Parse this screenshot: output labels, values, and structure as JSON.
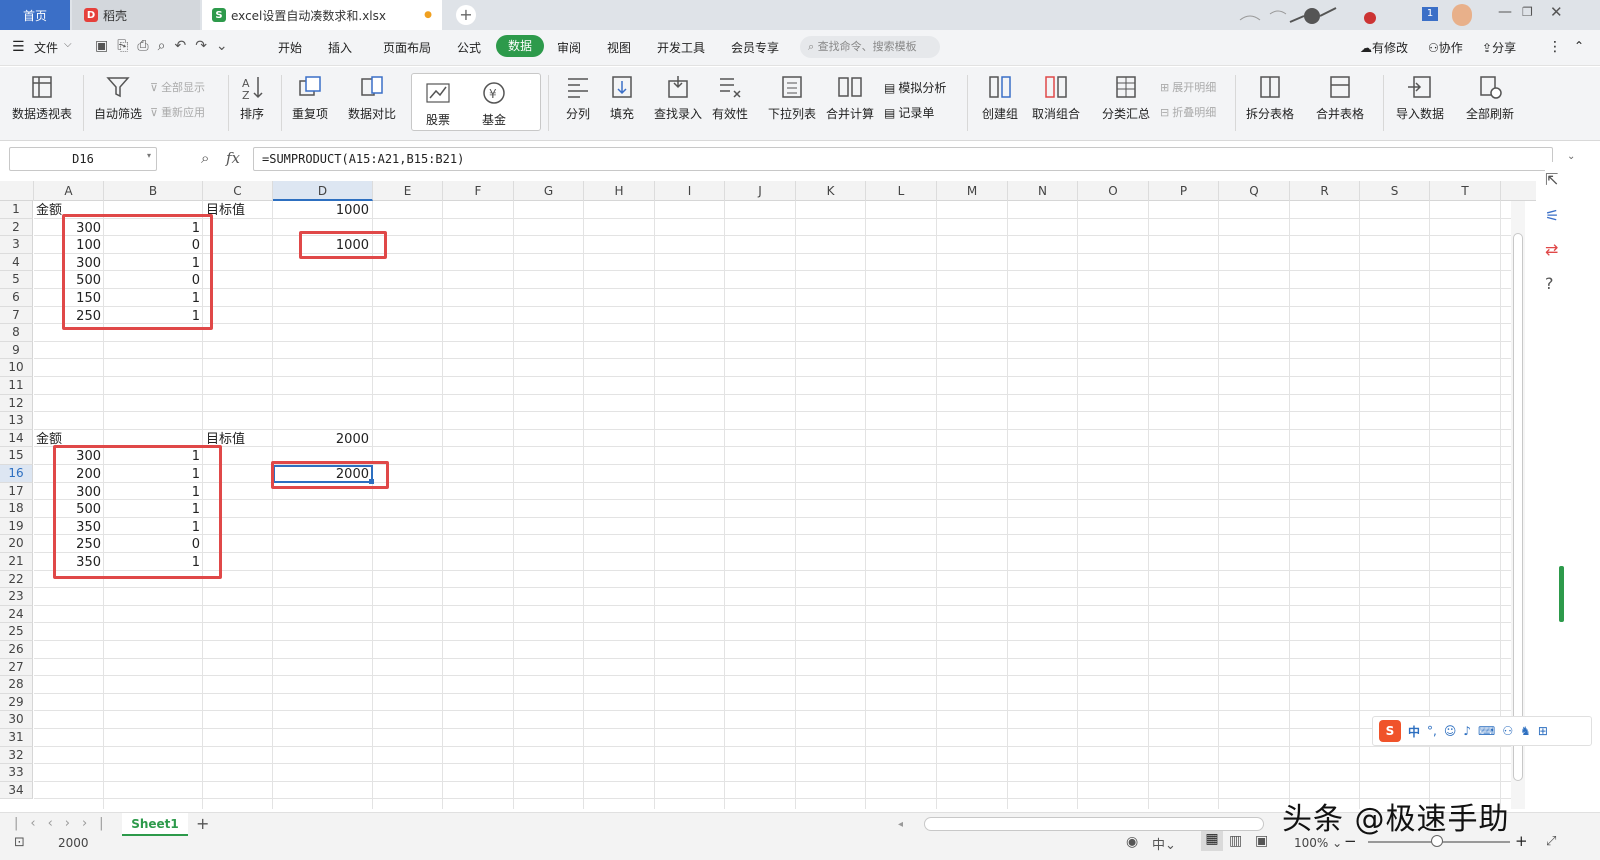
{
  "tabs": {
    "home": "首页",
    "wk": "稻壳",
    "file": "excel设置自动凑数求和.xlsx",
    "modified_dot": "●",
    "new_tab": "+",
    "badge": "1"
  },
  "menu": {
    "file": "文件",
    "items": [
      "开始",
      "插入",
      "页面布局",
      "公式",
      "数据",
      "审阅",
      "视图",
      "开发工具",
      "会员专享"
    ],
    "active": "数据",
    "search_placeholder": "查找命令、搜索模板",
    "changes": "有修改",
    "collab": "协作",
    "share": "分享"
  },
  "ribbon": {
    "pivot": "数据透视表",
    "autofilter": "自动筛选",
    "show_all": "全部显示",
    "reapply": "重新应用",
    "sort": "排序",
    "duplicates": "重复项",
    "compare": "数据对比",
    "stock": "股票",
    "fund": "基金",
    "split": "分列",
    "fill": "填充",
    "lookup": "查找录入",
    "validity": "有效性",
    "dropdown": "下拉列表",
    "consolidate": "合并计算",
    "whatif": "模拟分析",
    "record": "记录单",
    "group": "创建组",
    "ungroup": "取消组合",
    "subtotal": "分类汇总",
    "expand": "展开明细",
    "collapse": "折叠明细",
    "split_table": "拆分表格",
    "merge_table": "合并表格",
    "import": "导入数据",
    "refresh_all": "全部刷新"
  },
  "formula_bar": {
    "cell_ref": "D16",
    "fx": "fx",
    "formula": "=SUMPRODUCT(A15:A21,B15:B21)"
  },
  "columns": [
    "A",
    "B",
    "C",
    "D",
    "E",
    "F",
    "G",
    "H",
    "I",
    "J",
    "K",
    "L",
    "M",
    "N",
    "O",
    "P",
    "Q",
    "R",
    "S",
    "T"
  ],
  "rows": [
    "1",
    "2",
    "3",
    "4",
    "5",
    "6",
    "7",
    "8",
    "9",
    "10",
    "11",
    "12",
    "13",
    "14",
    "15",
    "16",
    "17",
    "18",
    "19",
    "20",
    "21",
    "22",
    "23",
    "24",
    "25",
    "26",
    "27",
    "28",
    "29",
    "30",
    "31",
    "32",
    "33",
    "34"
  ],
  "cells": {
    "a1": "金额",
    "c1": "目标值",
    "d1": "1000",
    "d3": "1000",
    "block1": [
      [
        "300",
        "1"
      ],
      [
        "100",
        "0"
      ],
      [
        "300",
        "1"
      ],
      [
        "500",
        "0"
      ],
      [
        "150",
        "1"
      ],
      [
        "250",
        "1"
      ]
    ],
    "a14": "金额",
    "c14": "目标值",
    "d14": "2000",
    "d16": "2000",
    "block2": [
      [
        "300",
        "1"
      ],
      [
        "200",
        "1"
      ],
      [
        "300",
        "1"
      ],
      [
        "500",
        "1"
      ],
      [
        "350",
        "1"
      ],
      [
        "250",
        "0"
      ],
      [
        "350",
        "1"
      ]
    ]
  },
  "sheet": {
    "tab": "Sheet1",
    "add": "+"
  },
  "status": {
    "value": "2000",
    "zoom": "100%",
    "minus": "−",
    "plus": "+"
  },
  "ime": {
    "lang": "中",
    "punct": "°,"
  },
  "watermark": "头条 @极速手助",
  "colors": {
    "accent_green": "#2d9a4b",
    "highlight_red": "#e04848",
    "home_tab": "#3b6fc7"
  }
}
